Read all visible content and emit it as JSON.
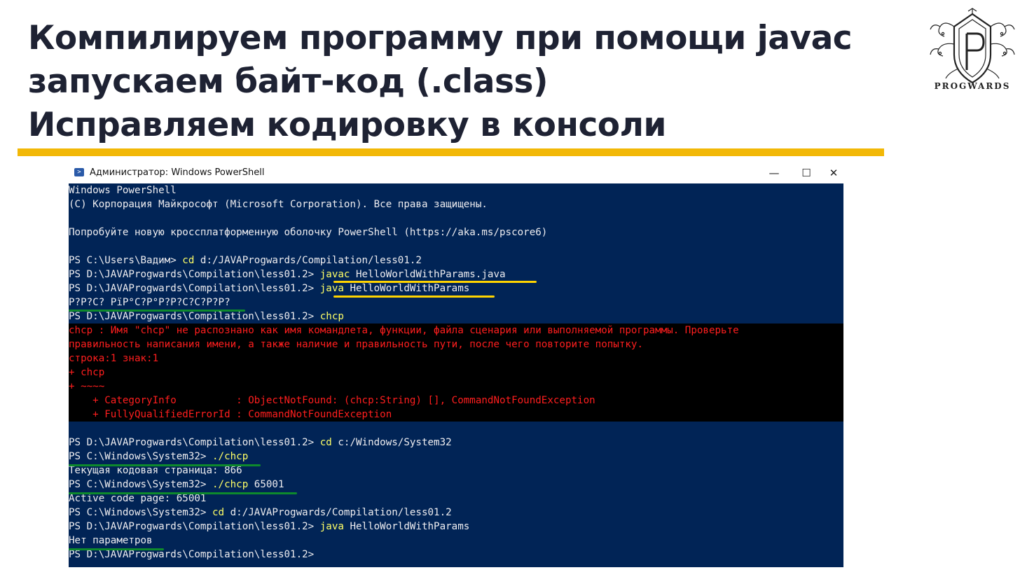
{
  "slide": {
    "title_lines": [
      "Компилируем программу при помощи javac",
      "запускаем  байт-код (.class)",
      "Исправляем кодировку в консоли"
    ],
    "logo_text": "PROGWARDS",
    "accent_color": "#f2b807"
  },
  "window": {
    "title": "Администратор: Windows PowerShell",
    "minimize_glyph": "—",
    "maximize_glyph": "☐",
    "close_glyph": "✕",
    "console_bg": "#012456"
  },
  "console": {
    "lines": [
      {
        "type": "out",
        "text": "Windows PowerShell"
      },
      {
        "type": "out",
        "text": "(C) Корпорация Майкрософт (Microsoft Corporation). Все права защищены."
      },
      {
        "type": "out",
        "text": ""
      },
      {
        "type": "out",
        "text": "Попробуйте новую кроссплатформенную оболочку PowerShell (https://aka.ms/pscore6)"
      },
      {
        "type": "out",
        "text": ""
      },
      {
        "type": "prompt",
        "prompt": "PS C:\\Users\\Вадим> ",
        "cmd": "cd",
        "args": " d:/JAVAProgwards/Compilation/less01.2"
      },
      {
        "type": "prompt",
        "prompt": "PS D:\\JAVAProgwards\\Compilation\\less01.2> ",
        "cmd": "javac",
        "args": " HelloWorldWithParams.java"
      },
      {
        "type": "prompt",
        "prompt": "PS D:\\JAVAProgwards\\Compilation\\less01.2> ",
        "cmd": "java",
        "args": " HelloWorldWithParams"
      },
      {
        "type": "out",
        "text": "Р?Р?С? РїР°С?Р°Р?Р?С?С?Р?Р?"
      },
      {
        "type": "prompt",
        "prompt": "PS D:\\JAVAProgwards\\Compilation\\less01.2> ",
        "cmd": "chcp",
        "args": ""
      },
      {
        "type": "err",
        "text": "chcp : Имя \"chcp\" не распознано как имя командлета, функции, файла сценария или выполняемой программы. Проверьте"
      },
      {
        "type": "err",
        "text": "правильность написания имени, а также наличие и правильность пути, после чего повторите попытку."
      },
      {
        "type": "err",
        "text": "строка:1 знак:1"
      },
      {
        "type": "err",
        "text": "+ chcp"
      },
      {
        "type": "err",
        "text": "+ ~~~~"
      },
      {
        "type": "err",
        "text": "    + CategoryInfo          : ObjectNotFound: (chcp:String) [], CommandNotFoundException"
      },
      {
        "type": "err",
        "text": "    + FullyQualifiedErrorId : CommandNotFoundException"
      },
      {
        "type": "out",
        "text": ""
      },
      {
        "type": "prompt",
        "prompt": "PS D:\\JAVAProgwards\\Compilation\\less01.2> ",
        "cmd": "cd",
        "args": " c:/Windows/System32"
      },
      {
        "type": "prompt",
        "prompt": "PS C:\\Windows\\System32> ",
        "cmd": "./chcp",
        "args": ""
      },
      {
        "type": "out",
        "text": "Текущая кодовая страница: 866"
      },
      {
        "type": "prompt",
        "prompt": "PS C:\\Windows\\System32> ",
        "cmd": "./chcp",
        "args": " 65001"
      },
      {
        "type": "out",
        "text": "Active code page: 65001"
      },
      {
        "type": "prompt",
        "prompt": "PS C:\\Windows\\System32> ",
        "cmd": "cd",
        "args": " d:/JAVAProgwards/Compilation/less01.2"
      },
      {
        "type": "prompt",
        "prompt": "PS D:\\JAVAProgwards\\Compilation\\less01.2> ",
        "cmd": "java",
        "args": " HelloWorldWithParams"
      },
      {
        "type": "out",
        "text": "Нет параметров"
      },
      {
        "type": "prompt",
        "prompt": "PS D:\\JAVAProgwards\\Compilation\\less01.2> ",
        "cmd": "",
        "args": ""
      }
    ]
  },
  "annotations": {
    "highlight_yellow": "#ffd400",
    "highlight_green": "#0e8a2c"
  }
}
